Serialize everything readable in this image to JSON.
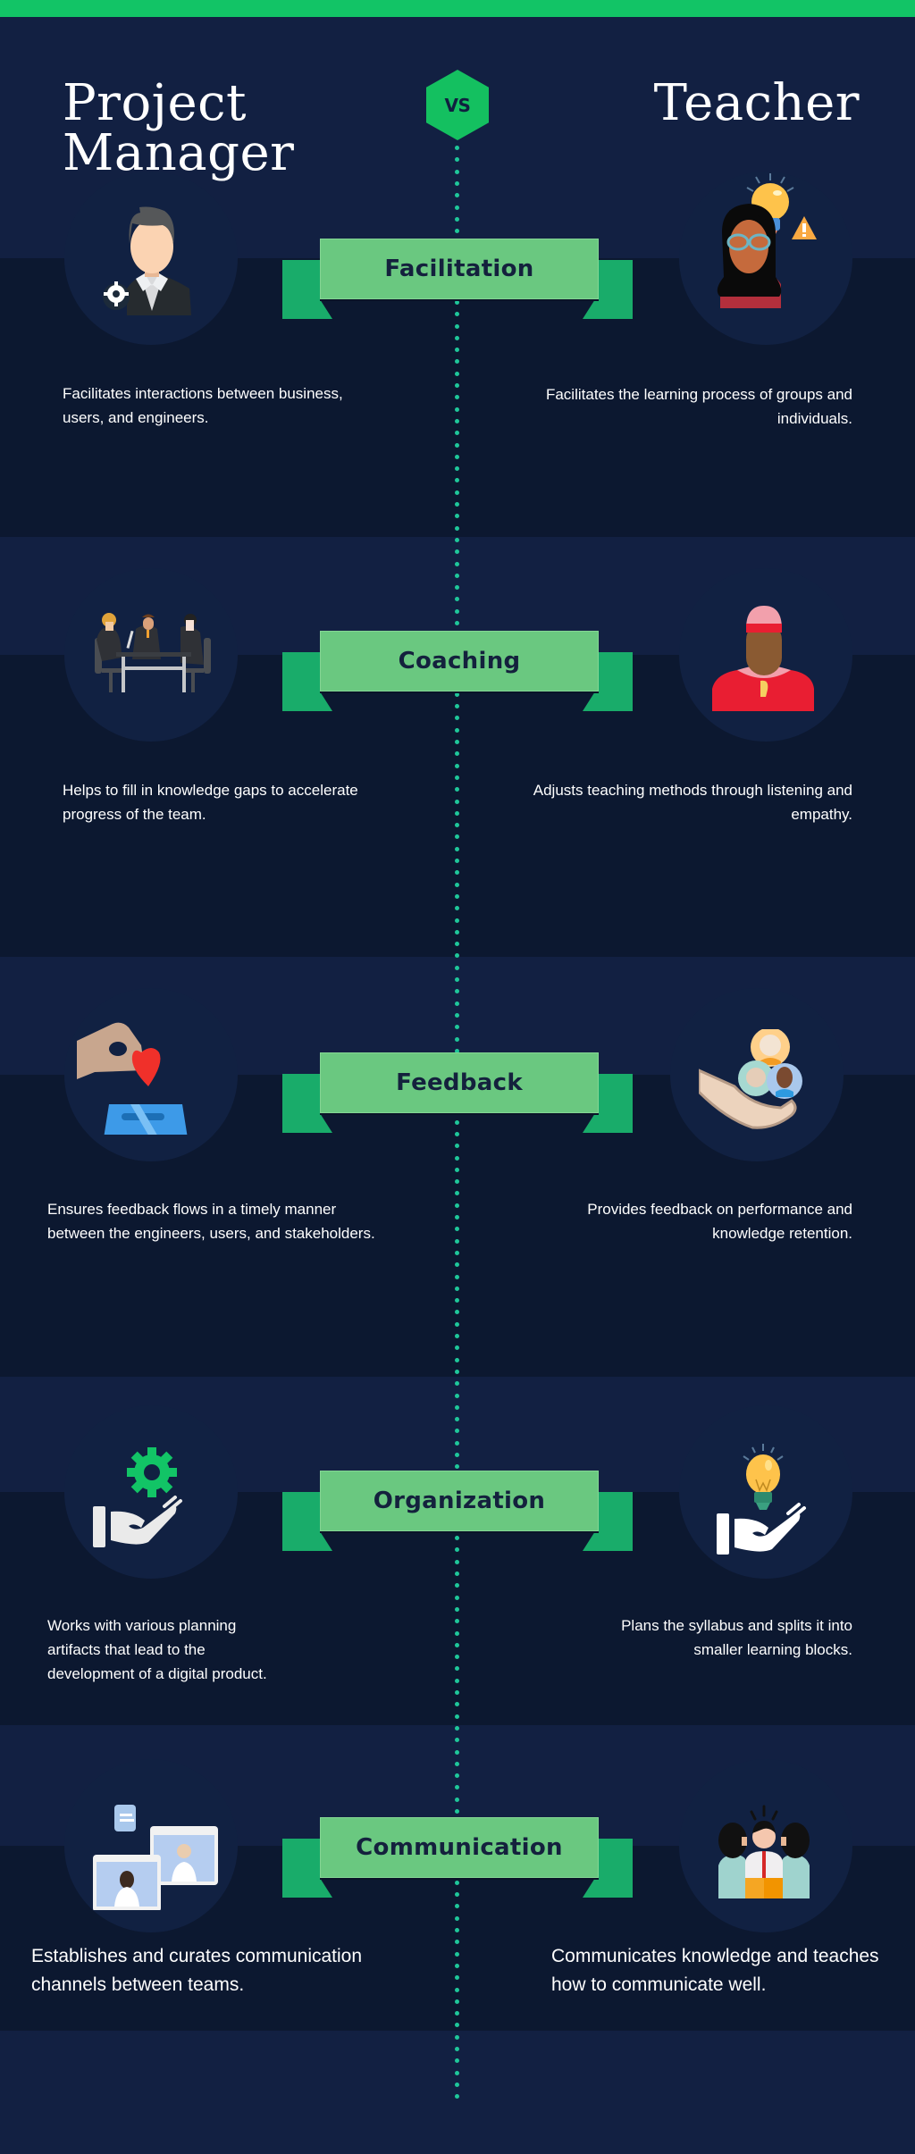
{
  "header": {
    "left_title_line1": "Project",
    "left_title_line2": "Manager",
    "vs_label": "VS",
    "right_title": "Teacher"
  },
  "colors": {
    "accent_green": "#12c466",
    "banner_green": "#6ac880",
    "banner_tail_green": "#19ac6a",
    "dot_teal": "#1fc79a",
    "bg_light": "#122042",
    "bg_dark": "#0c1830"
  },
  "sections": [
    {
      "label": "Facilitation",
      "left_icon": "manager-with-gear-icon",
      "right_icon": "teacher-with-lightbulb-icon",
      "left_text": "Facilitates interactions between business, users, and engineers.",
      "right_text": "Facilitates the learning process of groups and individuals."
    },
    {
      "label": "Coaching",
      "left_icon": "meeting-table-icon",
      "right_icon": "coach-with-whistle-icon",
      "left_text": "Helps to fill in knowledge gaps to accelerate progress of the team.",
      "right_text": "Adjusts teaching methods through listening and empathy."
    },
    {
      "label": "Feedback",
      "left_icon": "heart-ballot-box-icon",
      "right_icon": "hand-holding-people-icon",
      "left_text": "Ensures feedback flows in a timely manner between the engineers, users, and stakeholders.",
      "right_text": "Provides feedback on performance and knowledge retention."
    },
    {
      "label": "Organization",
      "left_icon": "hand-gear-icon",
      "right_icon": "hand-lightbulb-icon",
      "left_text": "Works with various planning artifacts that lead to the development of a digital product.",
      "right_text": "Plans the syllabus and splits it into smaller learning blocks."
    },
    {
      "label": "Communication",
      "left_icon": "video-chat-icon",
      "right_icon": "team-discussion-icon",
      "left_text": "Establishes and curates communication channels between teams.",
      "right_text": "Communicates knowledge and teaches how to communicate well."
    }
  ]
}
